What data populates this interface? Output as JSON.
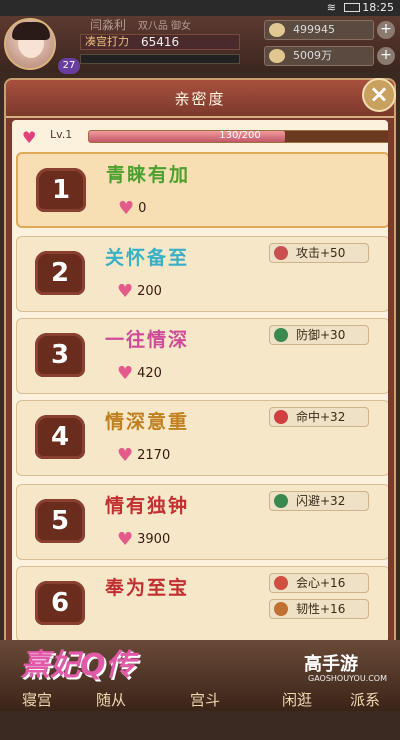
{
  "status": {
    "time": "18:25",
    "wifi": "wifi-icon",
    "battery": "battery-icon"
  },
  "hud": {
    "name": "闫淼利",
    "extra": "双八品 御女",
    "power_label": "凑宫打力",
    "power": "65416",
    "level": "27",
    "currency1": "499945",
    "currency2": "5009万"
  },
  "dialog": {
    "title": "亲密度",
    "close": "×",
    "level": "Lv.1",
    "progress_text": "130/200",
    "progress": 0.65,
    "colors": {
      "accent": "#e45a8a",
      "frame": "#7b3a2c",
      "panel": "#fbf1dd"
    }
  },
  "tiers": [
    {
      "num": "1",
      "title": "青睐有加",
      "amount": "0",
      "title_color": "#4d9f2f",
      "attrs": []
    },
    {
      "num": "2",
      "title": "关怀备至",
      "amount": "200",
      "title_color": "#3ab0c8",
      "attrs": [
        {
          "icon": "sword-icon",
          "text": "攻击+50",
          "color": "#c85050"
        }
      ]
    },
    {
      "num": "3",
      "title": "一往情深",
      "amount": "420",
      "title_color": "#d04a9a",
      "attrs": [
        {
          "icon": "shield-icon",
          "text": "防御+30",
          "color": "#3a8a50"
        }
      ]
    },
    {
      "num": "4",
      "title": "情深意重",
      "amount": "2170",
      "title_color": "#c08020",
      "attrs": [
        {
          "icon": "target-icon",
          "text": "命中+32",
          "color": "#d04040"
        }
      ]
    },
    {
      "num": "5",
      "title": "情有独钟",
      "amount": "3900",
      "title_color": "#c03030",
      "attrs": [
        {
          "icon": "dodge-icon",
          "text": "闪避+32",
          "color": "#3a8a50"
        }
      ]
    },
    {
      "num": "6",
      "title": "奉为至宝",
      "amount": "",
      "title_color": "#c03030",
      "attrs": [
        {
          "icon": "critical-icon",
          "text": "会心+16",
          "color": "#d05040"
        },
        {
          "icon": "toughness-icon",
          "text": "韧性+16",
          "color": "#c07030"
        }
      ]
    }
  ],
  "nav": [
    {
      "label": "寝宫"
    },
    {
      "label": "随从"
    },
    {
      "label": "宫斗"
    },
    {
      "label": "闲逛"
    },
    {
      "label": "派系"
    }
  ],
  "branding": {
    "game_logo": "熹妃Q传",
    "site": "高手游",
    "site_url": "GAOSHOUYOU.COM"
  }
}
